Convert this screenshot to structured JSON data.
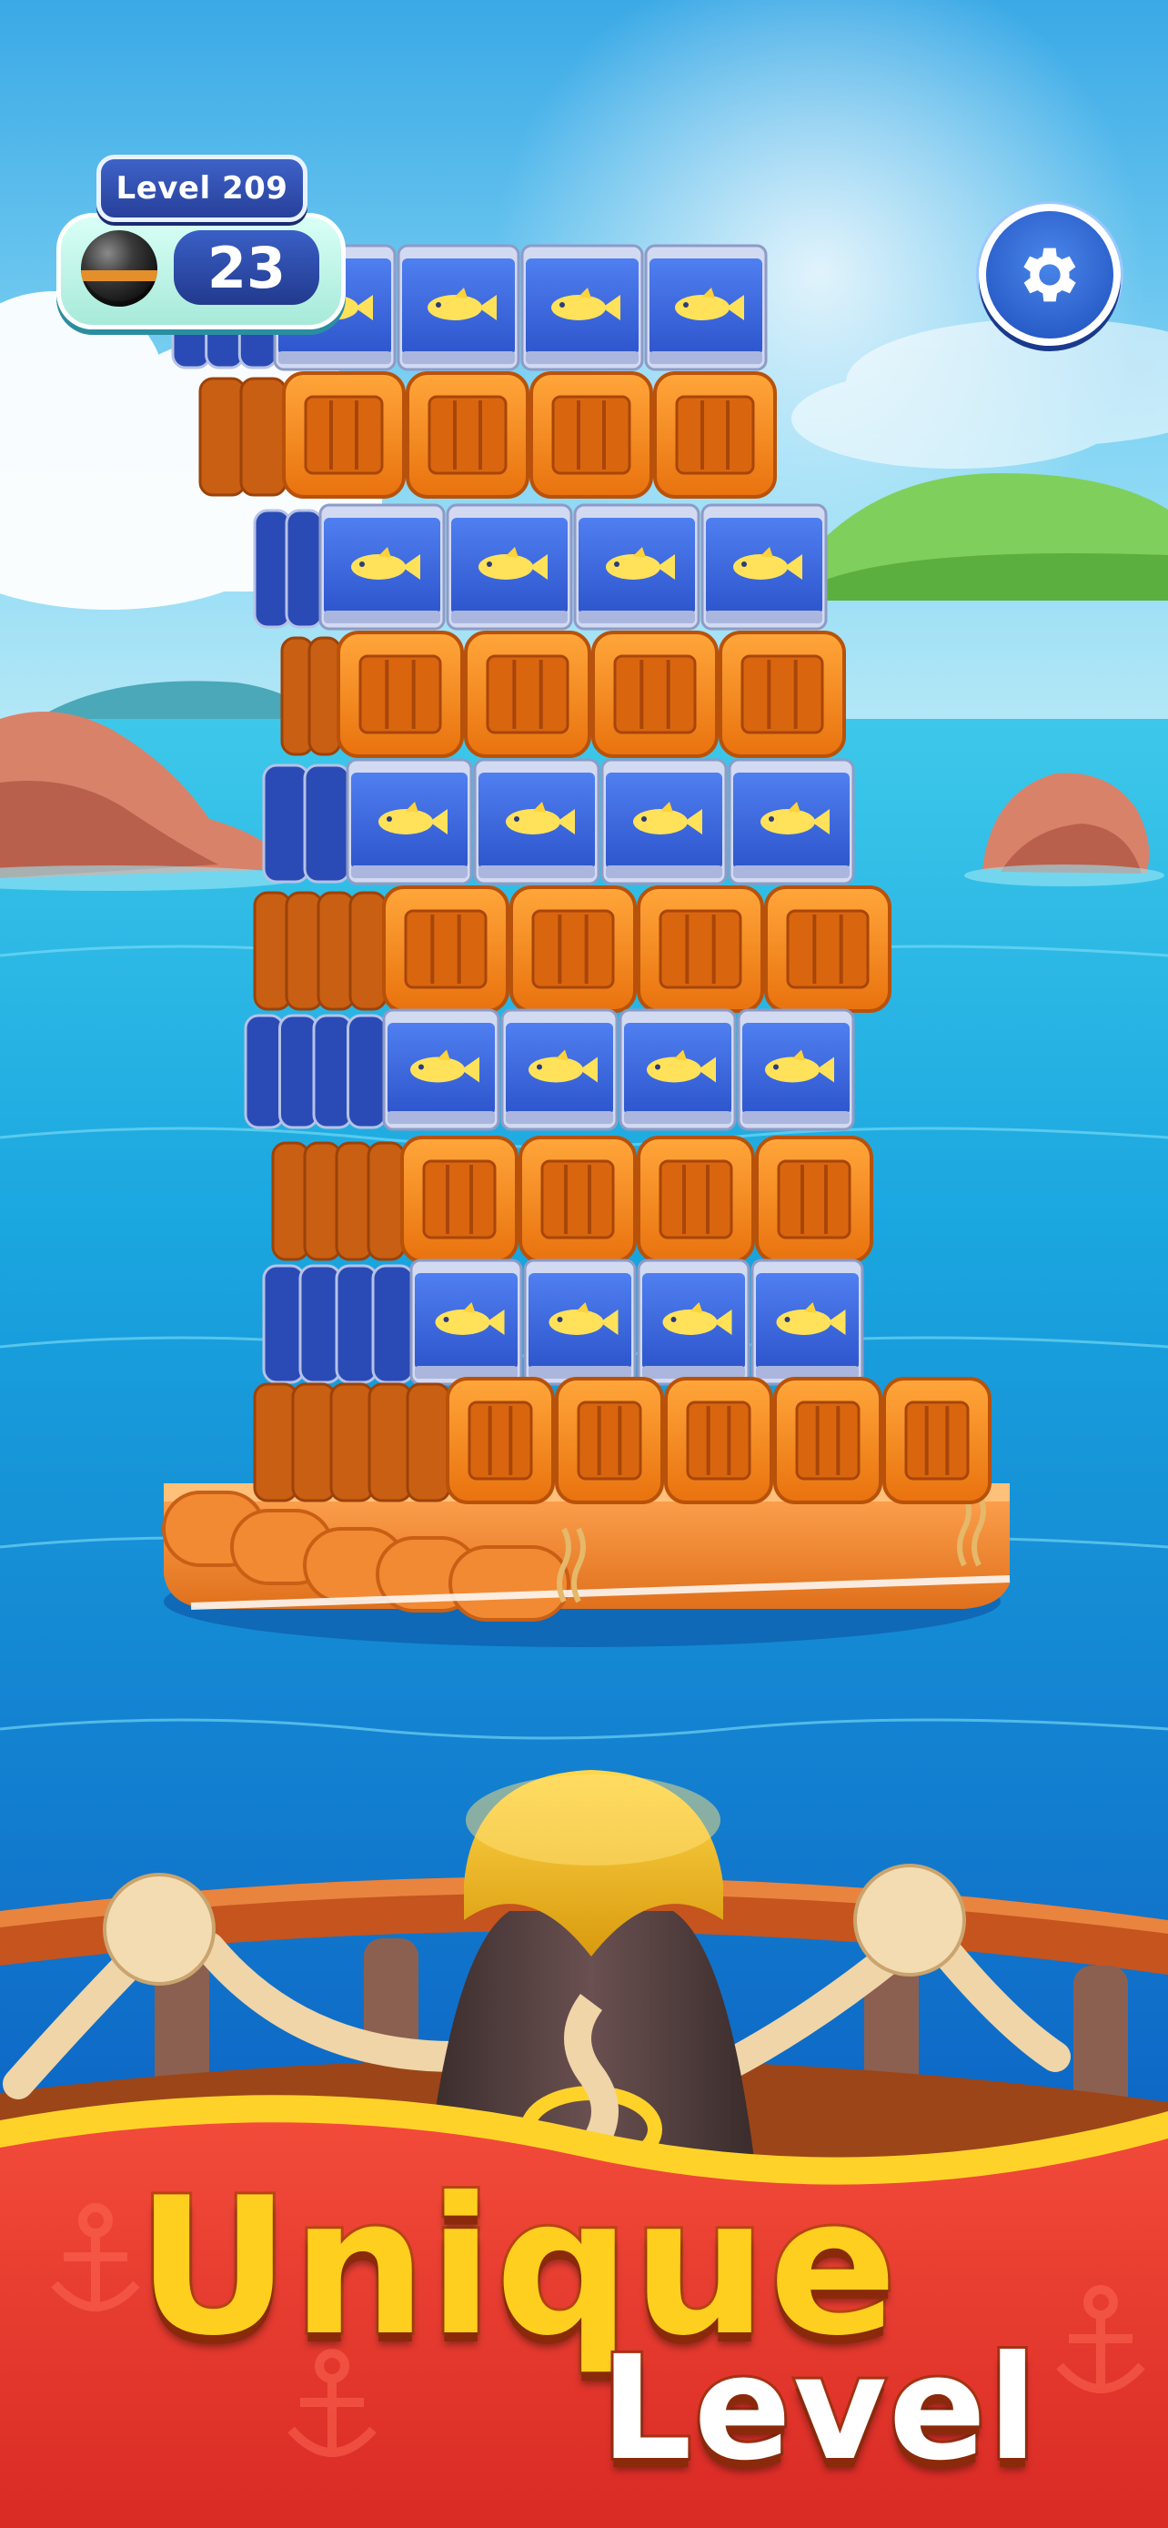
{
  "hud": {
    "level_label": "Level 209",
    "shots_remaining": "23",
    "shot_icon": "cannonball-icon",
    "settings_icon": "gear-icon"
  },
  "banner": {
    "line1": "Unique",
    "line2": "Level"
  },
  "colors": {
    "sky": "#5cc6f0",
    "sea": "#1f8fd8",
    "crate_orange": "#f58a1f",
    "crate_dark": "#c85b0c",
    "tin_blue": "#3d6ae0",
    "tin_silver": "#c9d2ee",
    "banner_red": "#e9342c",
    "banner_yellow": "#ffcf1f"
  },
  "tower": {
    "rows": [
      {
        "type": "tin",
        "count": 4
      },
      {
        "type": "crate",
        "count": 4
      },
      {
        "type": "tin",
        "count": 4
      },
      {
        "type": "crate",
        "count": 4
      },
      {
        "type": "tin",
        "count": 4
      },
      {
        "type": "crate",
        "count": 4
      },
      {
        "type": "tin",
        "count": 4
      },
      {
        "type": "crate",
        "count": 4
      },
      {
        "type": "tin",
        "count": 4
      },
      {
        "type": "crate",
        "count": 5
      }
    ]
  }
}
